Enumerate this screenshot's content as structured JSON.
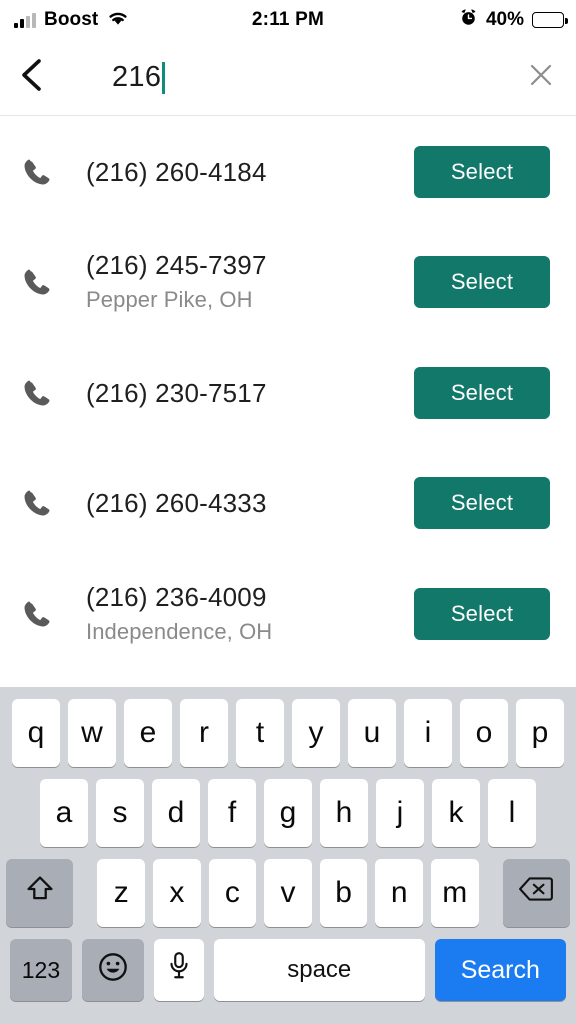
{
  "statusbar": {
    "carrier": "Boost",
    "time": "2:11 PM",
    "battery_percent": "40%",
    "signal_icon": "cellular-bars-icon",
    "wifi_icon": "wifi-icon",
    "alarm_icon": "alarm-clock-icon",
    "battery_icon": "battery-icon",
    "battery_level": 40
  },
  "header": {
    "back_icon": "chevron-left-icon",
    "search_value": "216",
    "search_placeholder": "Search",
    "clear_icon": "close-x-icon"
  },
  "results": [
    {
      "icon": "phone-icon",
      "number": "(216) 260-4184",
      "location": "",
      "action": "Select"
    },
    {
      "icon": "phone-icon",
      "number": "(216) 245-7397",
      "location": "Pepper Pike, OH",
      "action": "Select"
    },
    {
      "icon": "phone-icon",
      "number": "(216) 230-7517",
      "location": "",
      "action": "Select"
    },
    {
      "icon": "phone-icon",
      "number": "(216) 260-4333",
      "location": "",
      "action": "Select"
    },
    {
      "icon": "phone-icon",
      "number": "(216) 236-4009",
      "location": "Independence, OH",
      "action": "Select"
    }
  ],
  "keyboard": {
    "row1": [
      "q",
      "w",
      "e",
      "r",
      "t",
      "y",
      "u",
      "i",
      "o",
      "p"
    ],
    "row2": [
      "a",
      "s",
      "d",
      "f",
      "g",
      "h",
      "j",
      "k",
      "l"
    ],
    "row3": [
      "z",
      "x",
      "c",
      "v",
      "b",
      "n",
      "m"
    ],
    "shift_icon": "shift-arrow-icon",
    "backspace_icon": "backspace-delete-icon",
    "numeric_label": "123",
    "emoji_icon": "emoji-smiley-icon",
    "mic_icon": "microphone-icon",
    "space_label": "space",
    "search_label": "Search"
  },
  "colors": {
    "accent_teal": "#11786a",
    "search_blue": "#1a7cf0",
    "keyboard_bg": "#d1d4d9",
    "key_dark": "#a9aeb6"
  }
}
